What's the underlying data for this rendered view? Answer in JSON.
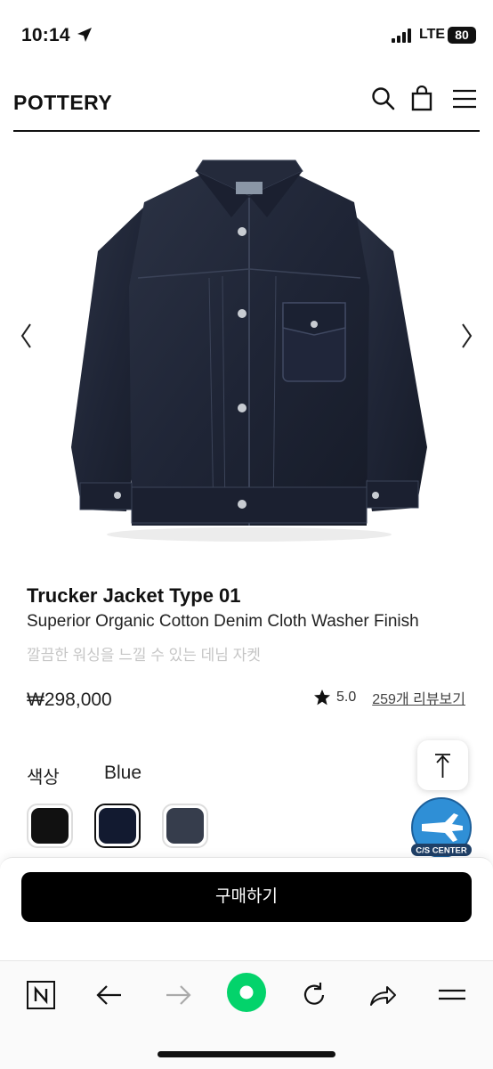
{
  "status_bar": {
    "time": "10:14",
    "network": "LTE",
    "battery": "80",
    "icons": [
      "location-arrow-icon",
      "signal-icon"
    ]
  },
  "header": {
    "logo": "POTTERY",
    "icons": [
      "search-icon",
      "shopping-bag-icon",
      "hamburger-menu-icon"
    ]
  },
  "gallery": {
    "image": "navy denim trucker jacket",
    "prev_icon": "chevron-left-icon",
    "next_icon": "chevron-right-icon"
  },
  "product": {
    "title": "Trucker Jacket Type 01",
    "subtitle": "Superior Organic Cotton Denim Cloth Washer Finish",
    "description": "깔끔한 워싱을 느낄 수 있는 데님 자켓",
    "price": "₩298,000",
    "rating": "5.0",
    "reviews_link": "259개 리뷰보기"
  },
  "color": {
    "label": "색상",
    "selected": "Blue",
    "swatches": [
      {
        "name": "black",
        "hex": "#111111"
      },
      {
        "name": "navy",
        "hex": "#121a30"
      },
      {
        "name": "charcoal-blue",
        "hex": "#363d4c"
      }
    ]
  },
  "floating": {
    "top_button_icon": "arrow-up-icon",
    "cs_label": "C/S CENTER"
  },
  "purchase": {
    "buy_label": "구매하기"
  },
  "browser_toolbar": {
    "icons": [
      "naver-n-icon",
      "back-arrow-icon",
      "forward-arrow-icon",
      "green-dot-home-icon",
      "refresh-icon",
      "share-icon",
      "menu-icon"
    ],
    "accent": "#03d36b"
  }
}
